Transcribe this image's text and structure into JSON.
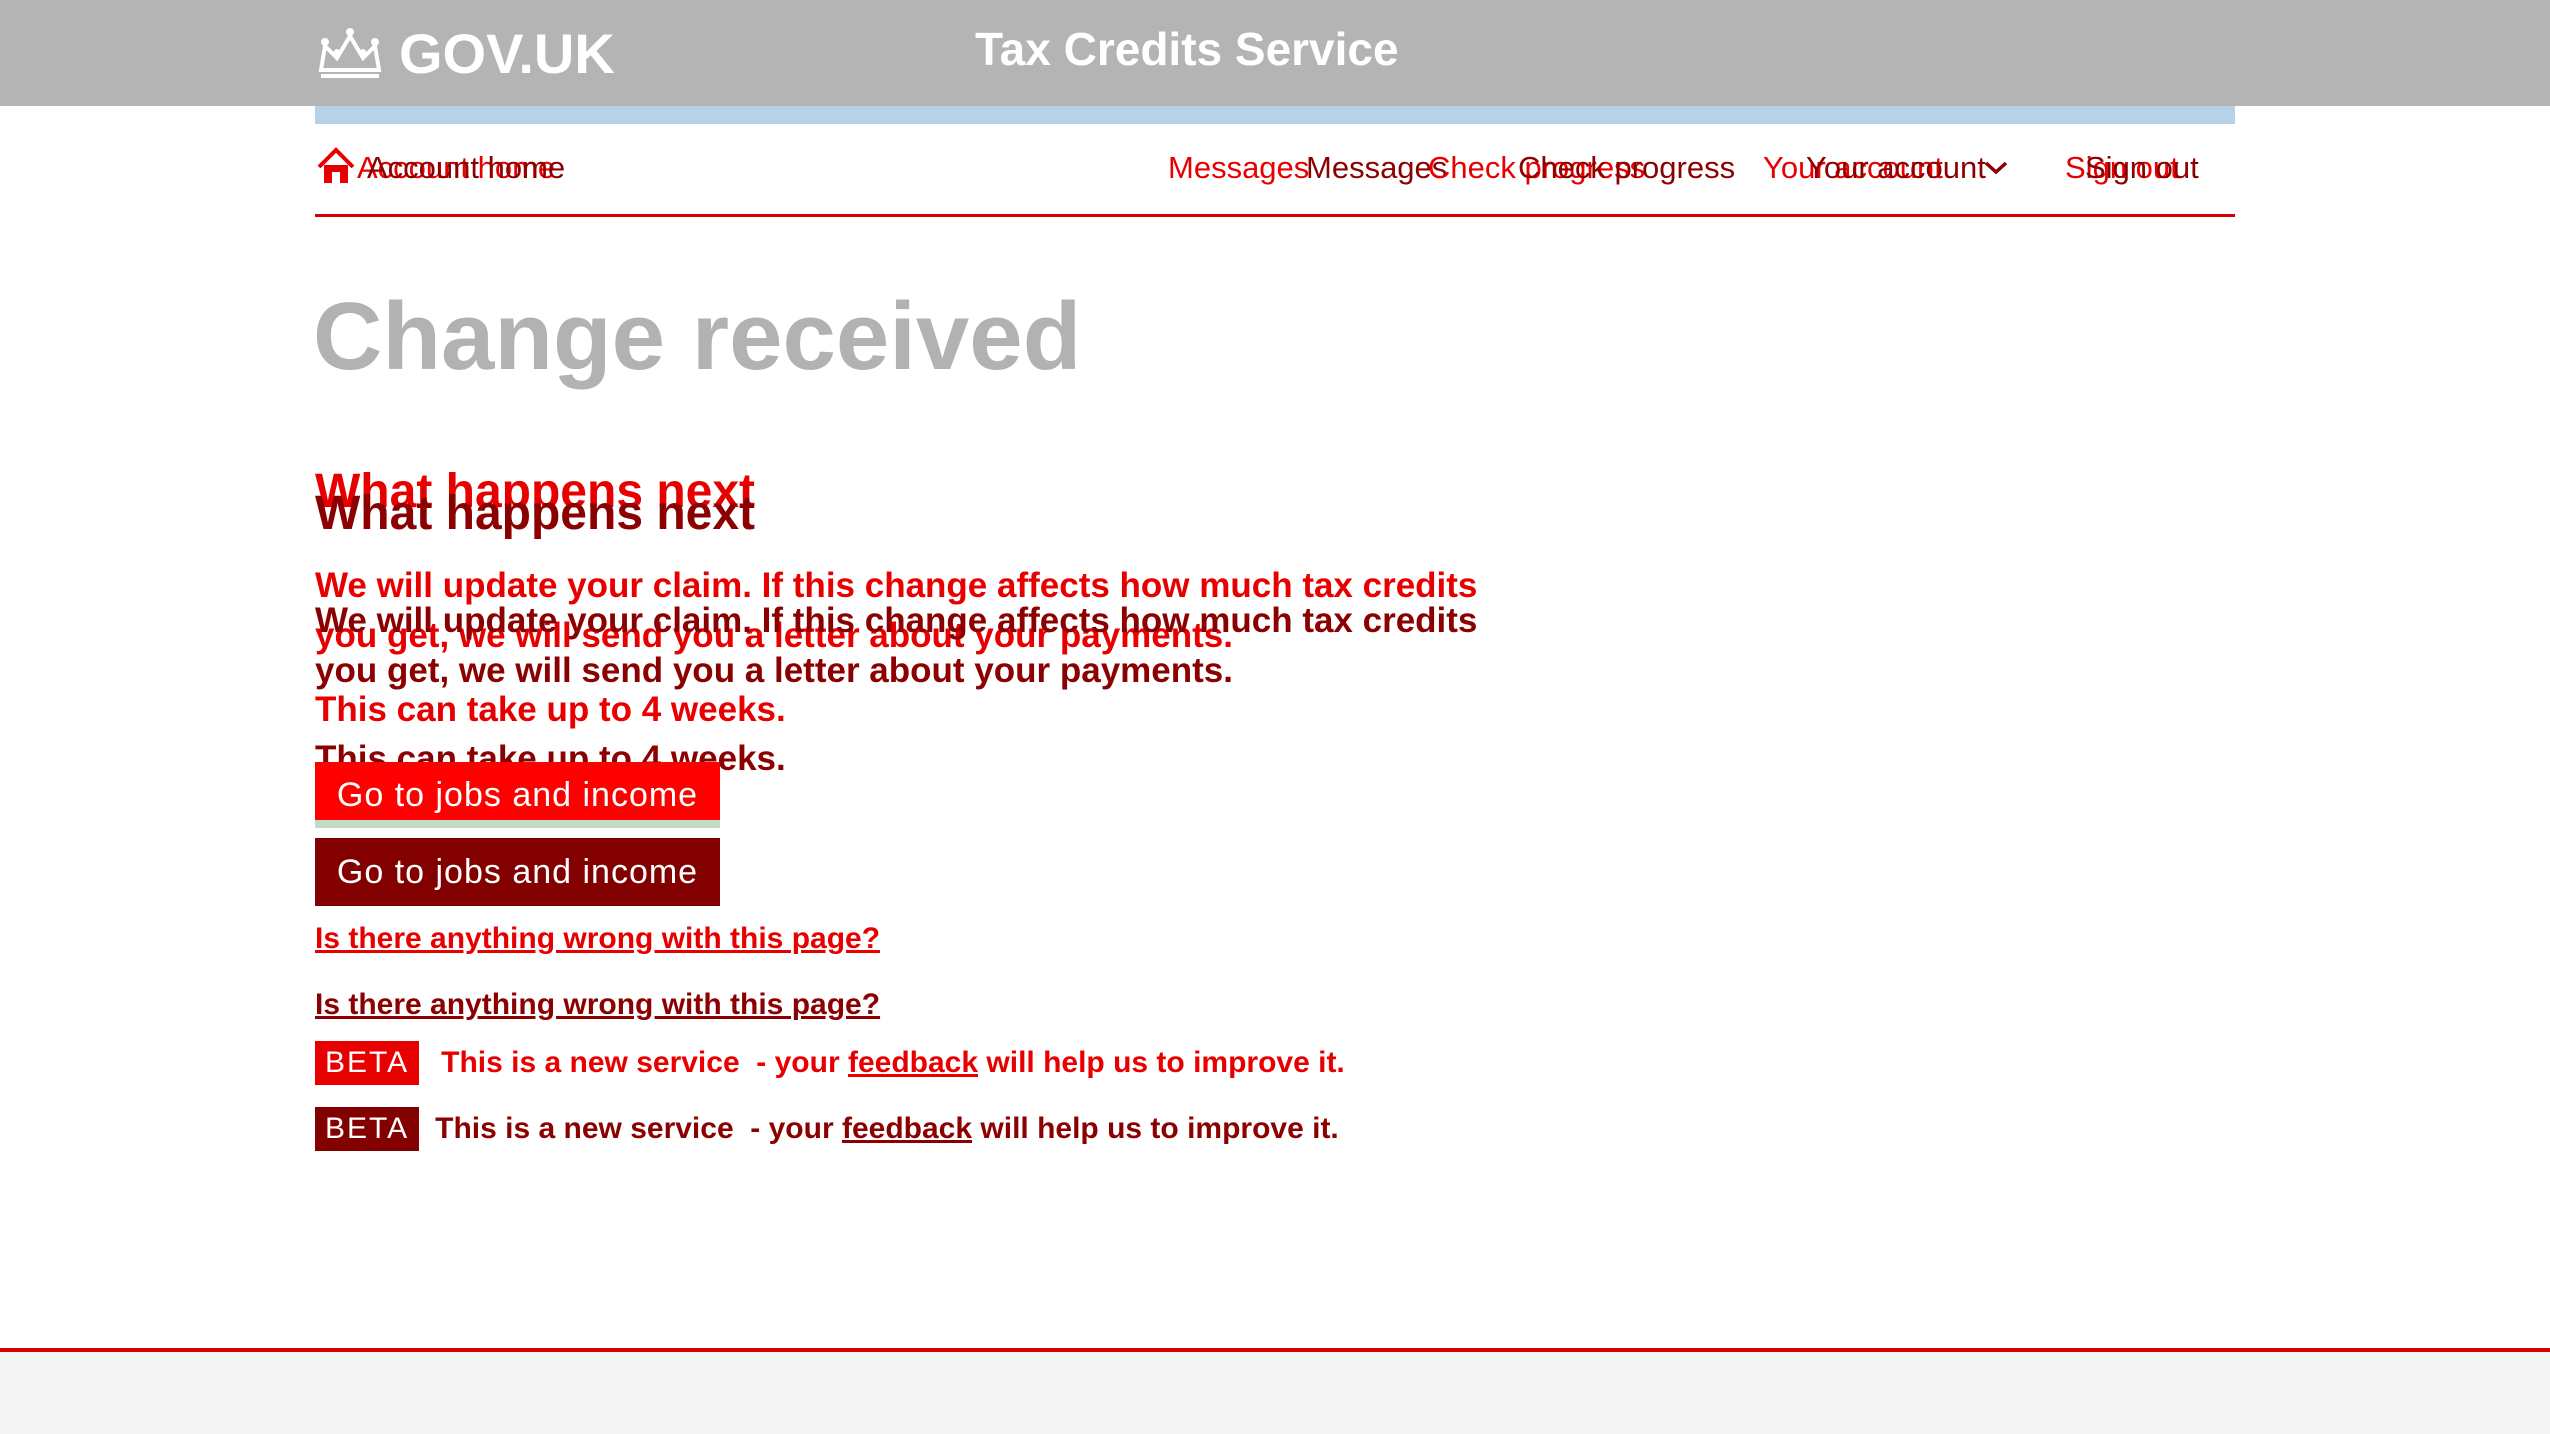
{
  "header": {
    "logo_text": "GOV.UK",
    "service_name": "Tax Credits Service"
  },
  "nav": {
    "account_home": "Account home",
    "messages": "Messages",
    "check_progress": "Check progress",
    "your_account": "Your account",
    "sign_out": "Sign out"
  },
  "main": {
    "title": "Change received",
    "section_heading": "What happens next",
    "paragraph_1": "We will update your claim. If this change affects how much tax credits you get, we will send you a letter about your payments.",
    "paragraph_2": "This can take up to 4 weeks.",
    "button_label": "Go to jobs and income",
    "problem_link": "Is there anything wrong with this page?"
  },
  "beta_banner": {
    "tag": "BETA",
    "text_before": "This is a new service  - your ",
    "link": "feedback",
    "text_after": " will help us to improve it."
  },
  "colors": {
    "header_bg": "#b4b4b4",
    "accent_red": "#e80000",
    "dark_red": "#8b0000",
    "phase_bar_blue": "#b7d1e6"
  }
}
